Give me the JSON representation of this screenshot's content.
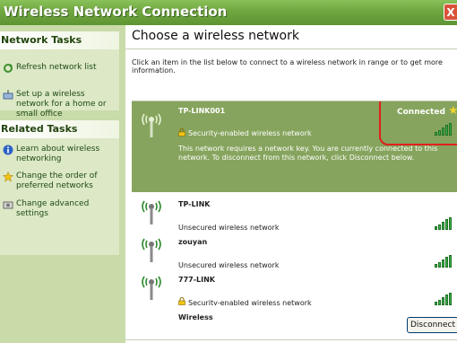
{
  "window": {
    "title": "Wireless Network Connection",
    "close_label": "X"
  },
  "sidebar": {
    "network_tasks": {
      "header": "Network Tasks",
      "items": [
        {
          "label": "Refresh network list",
          "icon": "refresh-icon"
        },
        {
          "label": "Set up a wireless network for a home or small office",
          "icon": "setup-wireless-icon"
        }
      ]
    },
    "related_tasks": {
      "header": "Related Tasks",
      "items": [
        {
          "label": "Learn about wireless networking",
          "icon": "info-icon"
        },
        {
          "label": "Change the order of preferred networks",
          "icon": "star-icon"
        },
        {
          "label": "Change advanced settings",
          "icon": "settings-icon"
        }
      ]
    }
  },
  "main": {
    "heading": "Choose a wireless network",
    "intro": "Click an item in the list below to connect to a wireless network in range or to get more information.",
    "networks": [
      {
        "name": "TP-LINK001",
        "status": "Security-enabled wireless network",
        "connected_label": "Connected",
        "selected": true,
        "detail": "This network requires a network key. You are currently connected to this network. To disconnect from this network, click Disconnect below.",
        "signal_bars": 5
      },
      {
        "name": "TP-LINK",
        "status": "Unsecured wireless network",
        "signal_bars": 5
      },
      {
        "name": "zouyan",
        "status": "Unsecured wireless network",
        "signal_bars": 5
      },
      {
        "name": "777-LINK",
        "status": "Security-enabled wireless network",
        "signal_bars": 5
      },
      {
        "name": "Wireless",
        "status": "",
        "signal_bars": 0
      }
    ],
    "disconnect_label": "Disconnect"
  },
  "colors": {
    "titlebar": "#6FA63F",
    "sidebar": "#C8DBA9",
    "selected_row": "#86A45D",
    "highlight_ring": "#E0201C",
    "star": "#F3D22E"
  }
}
